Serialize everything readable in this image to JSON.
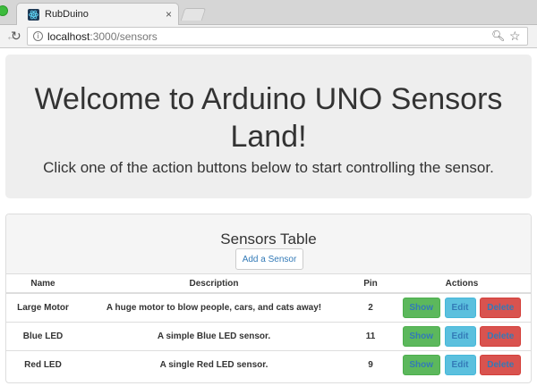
{
  "browser": {
    "tab_title": "RubDuino",
    "close_glyph": "×",
    "url_host": "localhost",
    "url_path": ":3000/sensors"
  },
  "jumbotron": {
    "title": "Welcome to Arduino UNO Sensors Land!",
    "subtitle": "Click one of the action buttons below to start controlling the sensor."
  },
  "panel": {
    "title": "Sensors Table",
    "add_button": "Add a Sensor"
  },
  "table": {
    "headers": {
      "name": "Name",
      "description": "Description",
      "pin": "Pin",
      "actions": "Actions"
    },
    "action_labels": {
      "show": "Show",
      "edit": "Edit",
      "delete": "Delete"
    },
    "rows": [
      {
        "name": "Large Motor",
        "description": "A huge motor to blow people, cars, and cats away!",
        "pin": "2"
      },
      {
        "name": "Blue LED",
        "description": "A simple Blue LED sensor.",
        "pin": "11"
      },
      {
        "name": "Red LED",
        "description": "A single Red LED sensor.",
        "pin": "9"
      }
    ]
  },
  "colors": {
    "show": "#5cb85c",
    "edit": "#5bc0de",
    "delete": "#d9534f",
    "link": "#337ab7"
  }
}
